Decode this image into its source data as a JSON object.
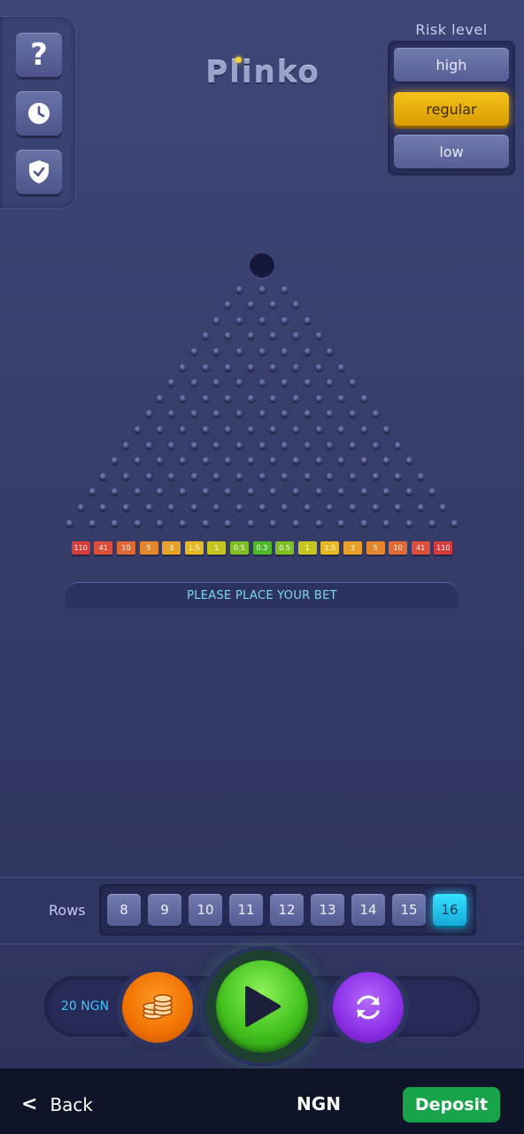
{
  "logo": {
    "text": "Plinko"
  },
  "tools": {
    "help_label": "?",
    "history_icon": "clock-icon",
    "fairness_icon": "shield-check-icon"
  },
  "risk": {
    "title": "Risk level",
    "options": [
      "high",
      "regular",
      "low"
    ],
    "selected": "regular"
  },
  "board": {
    "rows": 16,
    "multipliers": [
      "110",
      "41",
      "10",
      "5",
      "3",
      "1.5",
      "1",
      "0.5",
      "0.3",
      "0.5",
      "1",
      "1.5",
      "3",
      "5",
      "10",
      "41",
      "110"
    ],
    "slot_colors": [
      "#d63c3c",
      "#dc4d3a",
      "#e06a36",
      "#e5862f",
      "#e9a229",
      "#e6b826",
      "#c6c51f",
      "#7fbf23",
      "#4cb82a",
      "#7fbf23",
      "#c6c51f",
      "#e6b826",
      "#e9a229",
      "#e5862f",
      "#e06a36",
      "#dc4d3a",
      "#d63c3c"
    ]
  },
  "message": "PLEASE PLACE YOUR BET",
  "rows": {
    "label": "Rows",
    "options": [
      "8",
      "9",
      "10",
      "11",
      "12",
      "13",
      "14",
      "15",
      "16"
    ],
    "selected": "16"
  },
  "controls": {
    "bet_amount": "20 NGN",
    "coin_icon": "coins-icon",
    "play_icon": "play-icon",
    "auto_icon": "refresh-icon"
  },
  "bottom": {
    "back_label": "Back",
    "currency": "NGN",
    "deposit_label": "Deposit"
  }
}
